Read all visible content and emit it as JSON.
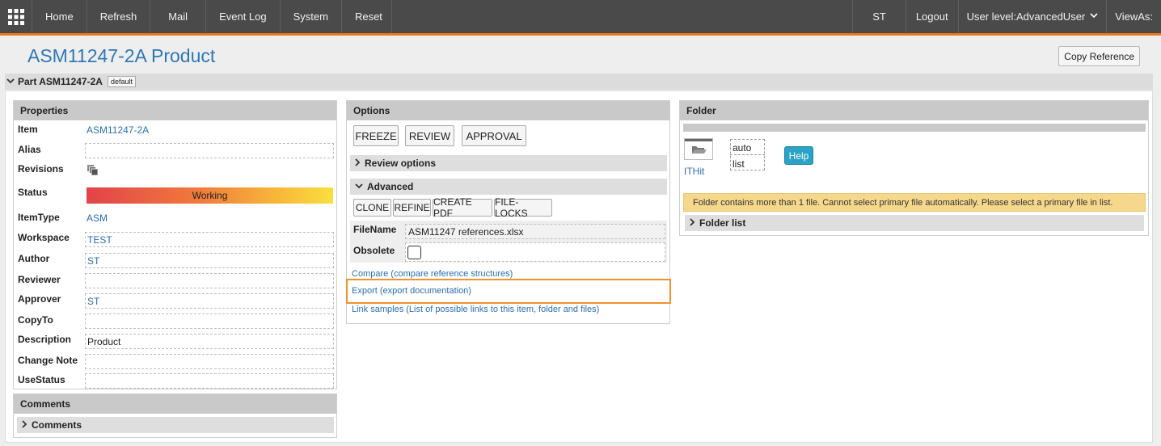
{
  "nav": {
    "items": [
      "Home",
      "Refresh",
      "Mail",
      "Event Log",
      "System",
      "Reset"
    ],
    "user_initials": "ST",
    "logout": "Logout",
    "user_level": "User level:AdvancedUser",
    "view_as": "ViewAs:"
  },
  "page": {
    "title": "ASM11247-2A Product",
    "copy_reference": "Copy Reference",
    "part_label": "Part ASM11247-2A",
    "part_badge": "default"
  },
  "properties": {
    "header": "Properties",
    "item_label": "Item",
    "item_value": "ASM11247-2A",
    "alias_label": "Alias",
    "alias_value": "",
    "revisions_label": "Revisions",
    "status_label": "Status",
    "status_value": "Working",
    "itemtype_label": "ItemType",
    "itemtype_value": "ASM",
    "workspace_label": "Workspace",
    "workspace_value": "TEST",
    "author_label": "Author",
    "author_value": "ST",
    "reviewer_label": "Reviewer",
    "reviewer_value": "",
    "approver_label": "Approver",
    "approver_value": "ST",
    "copyto_label": "CopyTo",
    "copyto_value": "",
    "description_label": "Description",
    "description_value": "Product",
    "changenote_label": "Change Note",
    "changenote_value": "",
    "usestatus_label": "UseStatus",
    "usestatus_value": ""
  },
  "comments": {
    "header": "Comments",
    "section": "Comments"
  },
  "options": {
    "header": "Options",
    "freeze": "FREEZE",
    "review": "REVIEW",
    "approval": "APPROVAL",
    "review_options": "Review options",
    "advanced": "Advanced",
    "clone": "CLONE",
    "refine": "REFINE",
    "create_pdf": "CREATE PDF",
    "file_locks": "FILE-LOCKS",
    "filename_label": "FileName",
    "filename_value": "ASM11247 references.xlsx",
    "obsolete_label": "Obsolete",
    "compare_link": "Compare (compare reference structures)",
    "export_link": "Export (export documentation)",
    "link_samples": "Link samples (List of possible links to this item, folder and files)"
  },
  "folder": {
    "header": "Folder",
    "folder_name": "ITHit",
    "mode_auto": "auto",
    "mode_list": "list",
    "help": "Help",
    "warning": "Folder contains more than 1 file. Cannot select primary file automatically. Please select a primary file in list.",
    "folder_list": "Folder list"
  },
  "colors": {
    "accent": "#e8771d",
    "link": "#2a6fb0",
    "nav_bg": "#4a4a4a",
    "help": "#2ba3c4"
  }
}
